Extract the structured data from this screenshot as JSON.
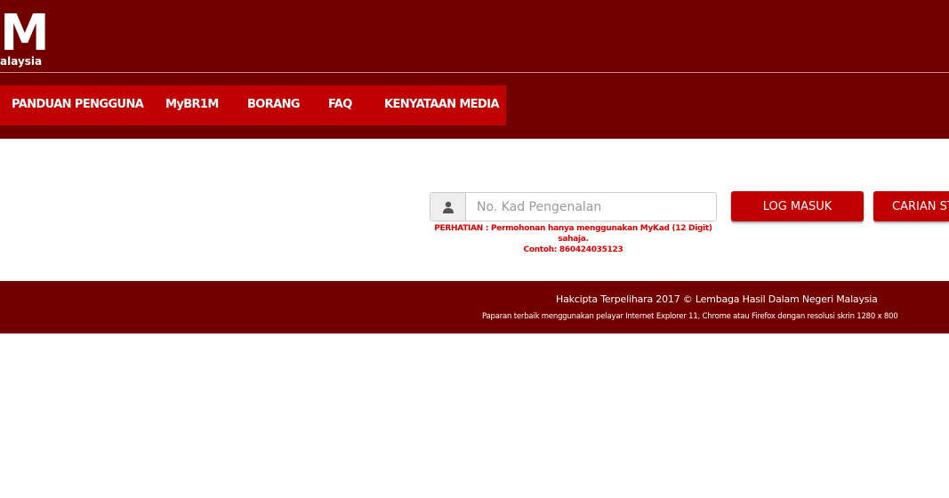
{
  "header": {
    "logo_main": "M",
    "logo_sub": "alaysia"
  },
  "nav": {
    "items": [
      {
        "label": "PANDUAN PENGGUNA"
      },
      {
        "label": "MyBR1M"
      },
      {
        "label": "BORANG"
      },
      {
        "label": "FAQ"
      },
      {
        "label": "KENYATAAN MEDIA"
      }
    ]
  },
  "login": {
    "ic_placeholder": "No. Kad Pengenalan",
    "ic_value": "",
    "user_icon": "user-icon",
    "notice_line1": "PERHATIAN : Permohonan hanya menggunakan MyKad (12 Digit) sahaja.",
    "notice_line2": "Contoh: 860424035123",
    "login_button": "LOG MASUK",
    "search_button": "CARIAN STATUS"
  },
  "footer": {
    "copyright": "Hakcipta Terpelihara 2017 © Lembaga Hasil Dalam Negeri Malaysia",
    "browser_note": "Paparan terbaik menggunakan pelayar Internet Explorer 11, Chrome atau Firefox dengan resolusi skrin 1280 x 800"
  },
  "colors": {
    "header_bg": "#730000",
    "nav_bg": "#c00000",
    "button_bg": "#c00000",
    "notice_text": "#e00000"
  }
}
